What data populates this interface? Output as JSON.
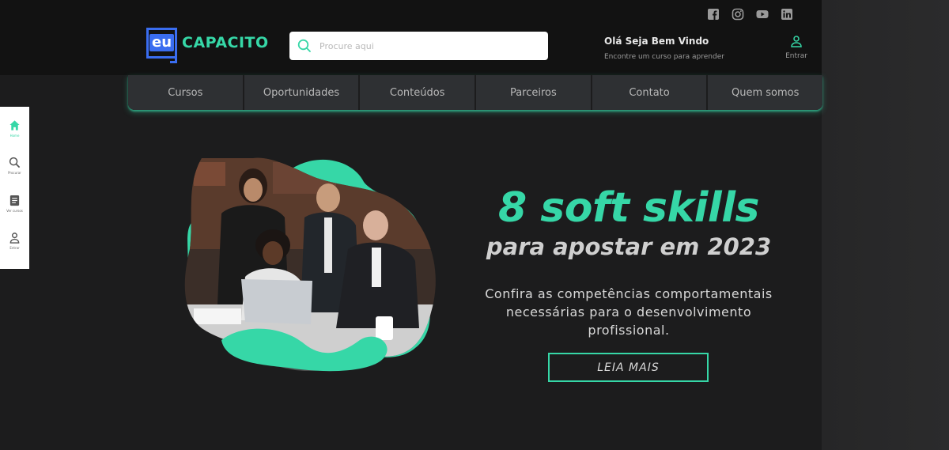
{
  "brand": {
    "logo_mark": "eu",
    "logo_text": "CAPACITO",
    "accent": "#36d7a7",
    "logo_blue": "#3a6df0"
  },
  "social": [
    {
      "icon": "facebook-icon"
    },
    {
      "icon": "instagram-icon"
    },
    {
      "icon": "youtube-icon"
    },
    {
      "icon": "linkedin-icon"
    }
  ],
  "search": {
    "placeholder": "Procure aqui",
    "value": ""
  },
  "welcome": {
    "title": "Olá Seja Bem Vindo",
    "subtitle": "Encontre um curso para aprender"
  },
  "login": {
    "label": "Entrar"
  },
  "nav": [
    {
      "label": "Cursos"
    },
    {
      "label": "Oportunidades"
    },
    {
      "label": "Conteúdos"
    },
    {
      "label": "Parceiros"
    },
    {
      "label": "Contato"
    },
    {
      "label": "Quem somos"
    }
  ],
  "sidebar": [
    {
      "label": "Home",
      "icon": "home-icon"
    },
    {
      "label": "Procurar",
      "icon": "search-icon"
    },
    {
      "label": "Ver cursos",
      "icon": "document-icon"
    },
    {
      "label": "Entrar",
      "icon": "user-icon"
    }
  ],
  "hero": {
    "title": "8 soft skills",
    "subtitle": "para apostar em 2023",
    "description_line1": "Confira  as competências comportamentais",
    "description_line2": "necessárias para o desenvolvimento",
    "description_line3": "profissional.",
    "cta": "LEIA MAIS"
  }
}
